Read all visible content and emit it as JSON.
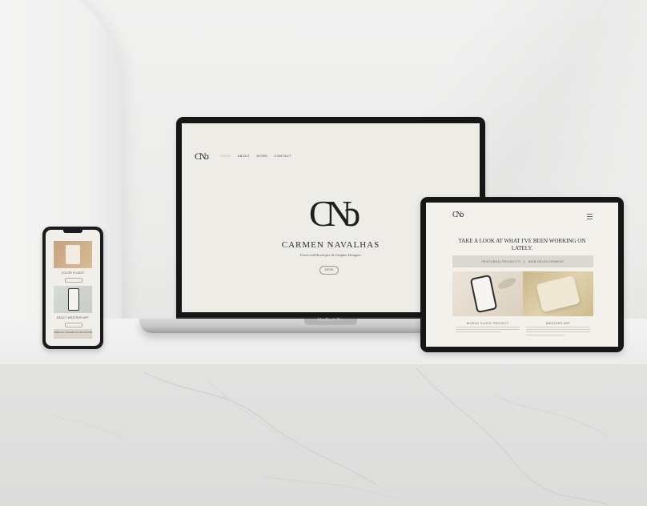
{
  "laptop": {
    "logo": "CNↄ",
    "nav": [
      "HOME",
      "ABOUT",
      "WORK",
      "CONTACT"
    ],
    "monogram": "CNↄ",
    "name": "CARMEN NAVALHAS",
    "subtitle": "Front-end Developer & Graphic Designer",
    "button": "ENTER",
    "brand_label": "MacBook Pro"
  },
  "tablet": {
    "logo": "CNↄ",
    "heading": "TAKE A LOOK AT WHAT I'VE BEEN WORKING ON LATELY.",
    "tabs": [
      "FEATURED PROJECTS",
      "WEB DEVELOPMENT"
    ],
    "tab_separator": "|",
    "projects": [
      {
        "title": "WORLD CLOCK PROJECT"
      },
      {
        "title": "WEATHER APP"
      }
    ]
  },
  "phone": {
    "cards": [
      {
        "title": "COLOR FLUENT"
      },
      {
        "title": "REACT WEATHER APP"
      }
    ],
    "footer": "VIEW ALL PROJECTS ON GITHUB"
  },
  "colors": {
    "screen_bg": "#eeece6",
    "device_frame": "#161616",
    "tab_bar": "#dcd8cf"
  }
}
